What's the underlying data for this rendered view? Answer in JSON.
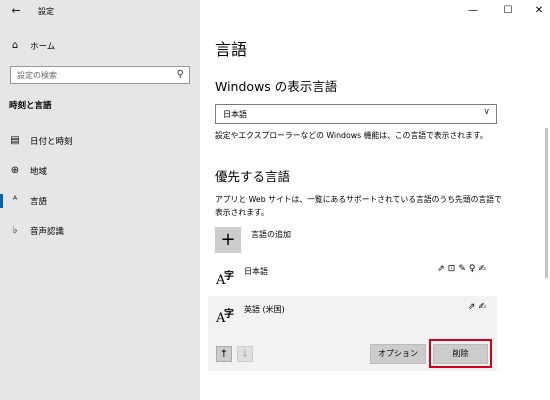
{
  "window": {
    "app_title": "設定",
    "back_label": "←",
    "minimize": "—",
    "maximize": "☐",
    "close": "✕"
  },
  "sidebar": {
    "home": {
      "label": "ホーム",
      "icon": "home-icon",
      "glyph": "⌂"
    },
    "search": {
      "placeholder": "設定の検索",
      "icon_glyph": "⚲"
    },
    "section": "時刻と言語",
    "items": [
      {
        "label": "日付と時刻",
        "icon": "calendar-clock-icon",
        "glyph": "▤"
      },
      {
        "label": "地域",
        "icon": "globe-icon",
        "glyph": "⊕"
      },
      {
        "label": "言語",
        "icon": "language-icon",
        "glyph": "ᴬ",
        "active": true
      },
      {
        "label": "音声認識",
        "icon": "microphone-icon",
        "glyph": "♭"
      }
    ]
  },
  "main": {
    "title": "言語",
    "display_language": {
      "heading": "Windows の表示言語",
      "selected": "日本語",
      "description": "設定やエクスプローラーなどの Windows 機能は、この言語で表示されます。"
    },
    "preferred": {
      "heading": "優先する言語",
      "description": "アプリと Web サイトは、一覧にあるサポートされている言語のうち先頭の言語で表示されます。",
      "add_label": "言語の追加",
      "languages": [
        {
          "name": "日本語",
          "features": "⇗⊡✎♀✍"
        },
        {
          "name": "英語 (米国)",
          "features": "⇗✍"
        }
      ],
      "options_button": "オプション",
      "remove_button": "削除",
      "move_up": "↑",
      "move_down": "↓"
    }
  },
  "glyphs": {
    "a": "A",
    "ji": "字",
    "chevron": "∨",
    "plus": "+"
  },
  "colors": {
    "accent": "#0063b1",
    "highlight": "#d6001c"
  }
}
